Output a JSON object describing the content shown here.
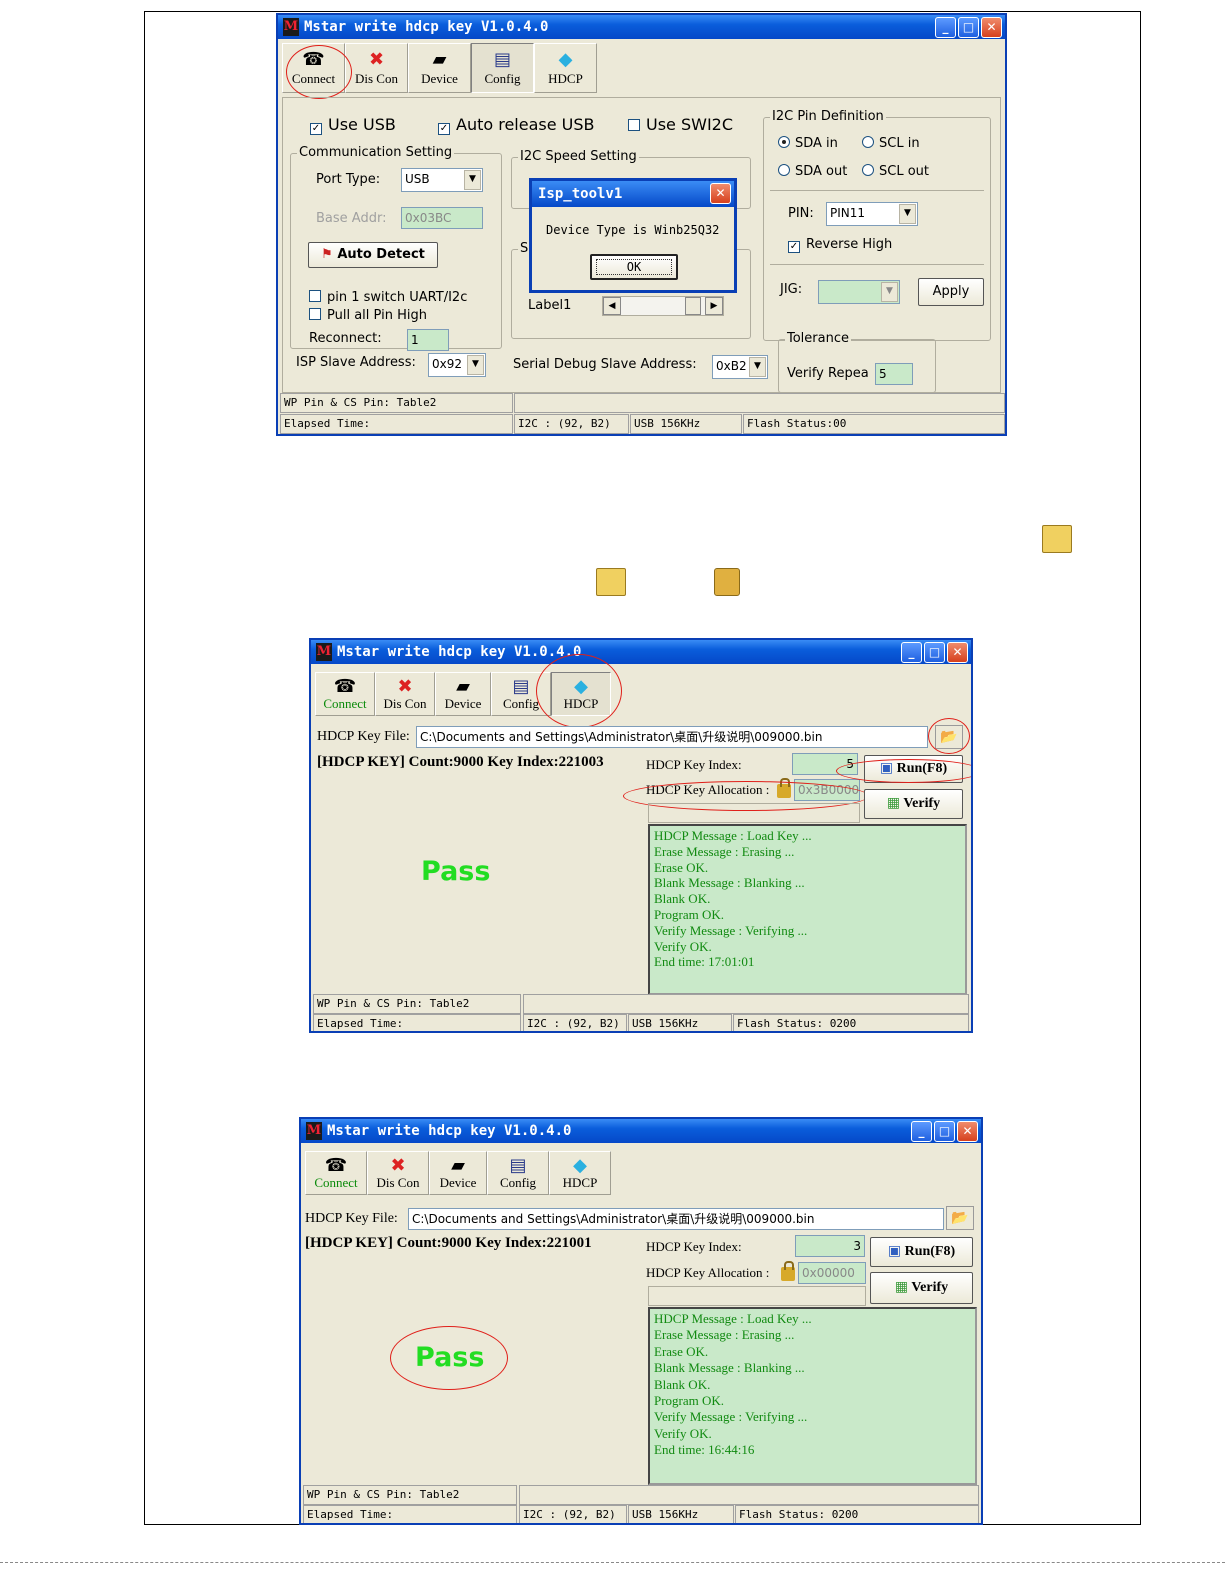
{
  "app": {
    "title": "Mstar write hdcp key V1.0.4.0",
    "logo_char": "M",
    "window_buttons": [
      "_",
      "□",
      "✕"
    ]
  },
  "toolbar": [
    {
      "label": "Connect",
      "icon": "connect-icon"
    },
    {
      "label": "Dis Con",
      "icon": "disconnect-icon"
    },
    {
      "label": "Device",
      "icon": "device-icon"
    },
    {
      "label": "Config",
      "icon": "config-icon"
    },
    {
      "label": "HDCP",
      "icon": "hdcp-icon"
    }
  ],
  "config": {
    "use_usb": "Use USB",
    "auto_release_usb": "Auto release USB",
    "use_swi2c": "Use SWI2C",
    "comm_group": "Communication Setting",
    "port_type_label": "Port Type:",
    "port_type_value": "USB",
    "base_addr_label": "Base Addr:",
    "base_addr_value": "0x03BC",
    "auto_detect": "Auto Detect",
    "pin1_switch": "pin 1 switch UART/I2c",
    "pull_all_pin": "Pull all Pin High",
    "reconnect_label": "Reconnect:",
    "reconnect_value": "1",
    "i2c_speed_group": "I2C Speed Setting",
    "group_s_letter": "S",
    "label1": "Label1",
    "isp_slave_label": "ISP Slave Address:",
    "isp_slave_value": "0x92",
    "serial_debug_label": "Serial Debug Slave Address:",
    "serial_debug_value": "0xB2",
    "pin_def_group": "I2C Pin Definition",
    "sda_in": "SDA in",
    "scl_in": "SCL in",
    "sda_out": "SDA out",
    "scl_out": "SCL out",
    "pin_label": "PIN:",
    "pin_value": "PIN11",
    "reverse_high": "Reverse High",
    "jig_label": "JIG:",
    "apply": "Apply",
    "tolerance_group": "Tolerance",
    "verify_repeat_label": "Verify Repea",
    "verify_repeat_value": "5"
  },
  "dialog": {
    "title": "Isp_toolv1",
    "message": "Device Type is Winb25Q32",
    "ok": "OK"
  },
  "status": {
    "wp_pin": "WP Pin & CS Pin: Table2",
    "elapsed": "Elapsed Time:",
    "i2c": "I2C : (92, B2)",
    "usb": "USB  156KHz",
    "flash_1": "Flash Status:00",
    "flash_2": "Flash Status: 0200"
  },
  "hdcp": {
    "key_file_label": "HDCP Key File:",
    "key_file_path": "C:\\Documents and Settings\\Administrator\\桌面\\升级说明\\009000.bin",
    "key_index_label": "HDCP Key Index:",
    "key_alloc_label": "HDCP Key Allocation :",
    "run": "Run(F8)",
    "verify": "Verify",
    "pass": "Pass"
  },
  "win2": {
    "summary": "[HDCP KEY] Count:9000  Key Index:221003",
    "key_index": "5",
    "key_alloc": "0x3B0000",
    "log": [
      "HDCP Message : Load Key ...",
      "Erase Message : Erasing ...",
      "Erase OK.",
      "Blank Message : Blanking ...",
      "Blank OK.",
      "Program OK.",
      "Verify Message : Verifying ...",
      "Verify OK.",
      "End time: 17:01:01"
    ]
  },
  "win3": {
    "summary": "[HDCP KEY] Count:9000  Key Index:221001",
    "key_index": "3",
    "key_alloc": "0x00000",
    "log": [
      "HDCP Message : Load Key ...",
      "Erase Message : Erasing ...",
      "Erase OK.",
      "Blank Message : Blanking ...",
      "Blank OK.",
      "Program OK.",
      "Verify Message : Verifying ...",
      "Verify OK.",
      "End time: 16:44:16"
    ]
  },
  "colors": {
    "title_blue": "#0a5ddb",
    "log_green_bg": "#c9e9c9",
    "pass_green": "#22dd22",
    "annotation_red": "#e0201a"
  }
}
